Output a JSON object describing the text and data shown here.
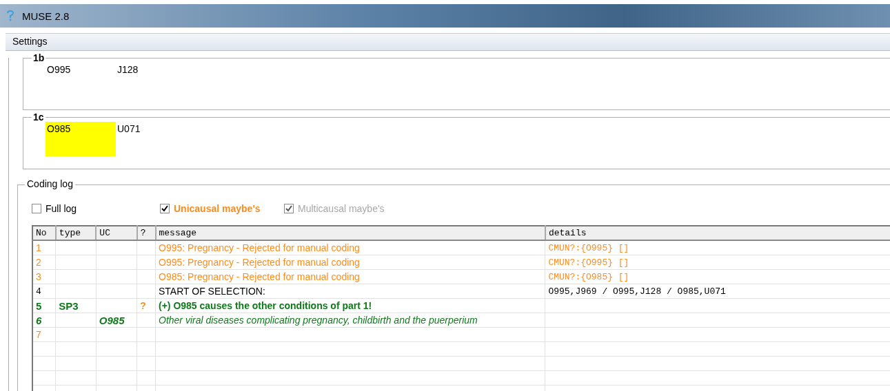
{
  "window": {
    "title": "MUSE 2.8"
  },
  "menu": [
    "Settings"
  ],
  "parts": [
    {
      "label": "1b",
      "codes": [
        {
          "code": "O995",
          "highlighted": false
        },
        {
          "code": "J128",
          "highlighted": false
        }
      ]
    },
    {
      "label": "1c",
      "codes": [
        {
          "code": "O985",
          "highlighted": true
        },
        {
          "code": "U071",
          "highlighted": false
        }
      ]
    }
  ],
  "coding_log": {
    "title": "Coding log",
    "options": [
      {
        "label": "Full log",
        "checked": false,
        "emphasis": false,
        "disabled": false
      },
      {
        "label": "Unicausal maybe's",
        "checked": true,
        "emphasis": true,
        "disabled": false
      },
      {
        "label": "Multicausal maybe's",
        "checked": true,
        "emphasis": false,
        "disabled": true
      }
    ],
    "columns": [
      "No",
      "type",
      "UC",
      "?",
      "message",
      "details"
    ],
    "rows": [
      {
        "kind": "warning",
        "no": "1",
        "type": "",
        "uc": "",
        "q": "",
        "message": "O995: Pregnancy - Rejected for manual coding",
        "details": "CMUN?:{O995} []"
      },
      {
        "kind": "warning",
        "no": "2",
        "type": "",
        "uc": "",
        "q": "",
        "message": "O995: Pregnancy - Rejected for manual coding",
        "details": "CMUN?:{O995} []"
      },
      {
        "kind": "warning",
        "no": "3",
        "type": "",
        "uc": "",
        "q": "",
        "message": "O985: Pregnancy - Rejected for manual coding",
        "details": "CMUN?:{O985} []"
      },
      {
        "kind": "plain",
        "no": "4",
        "type": "",
        "uc": "",
        "q": "",
        "message": "START OF SELECTION:",
        "details": "O995,J969 / O995,J128 / O985,U071"
      },
      {
        "kind": "result",
        "no": "5",
        "type": "SP3",
        "uc": "",
        "q": "?",
        "message": "(+) O985  causes the other conditions of part 1!",
        "details": ""
      },
      {
        "kind": "description",
        "no": "6",
        "type": "",
        "uc": "O985",
        "q": "",
        "message": "Other viral diseases complicating pregnancy, childbirth and the puerperium",
        "details": ""
      },
      {
        "kind": "warning",
        "no": "7",
        "type": "",
        "uc": "",
        "q": "",
        "message": "",
        "details": ""
      }
    ]
  }
}
